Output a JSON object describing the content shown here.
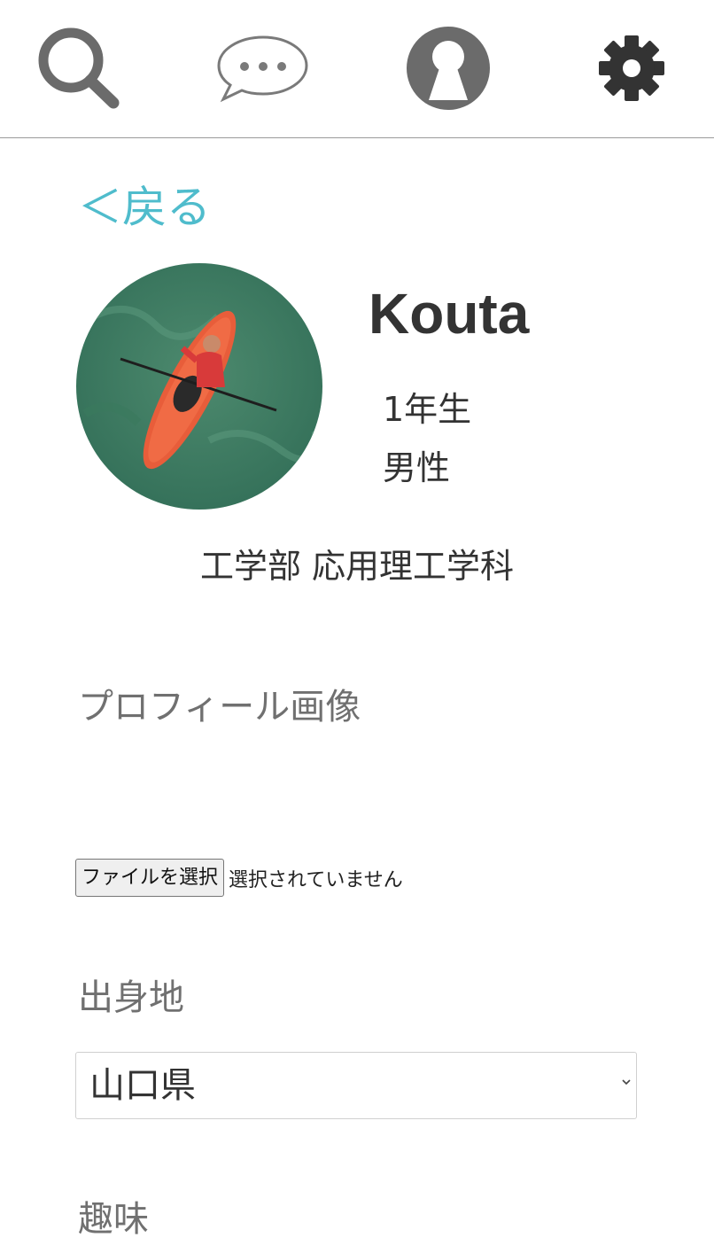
{
  "nav": {
    "items": [
      {
        "icon": "search-icon"
      },
      {
        "icon": "chat-bubble-icon"
      },
      {
        "icon": "profile-icon"
      },
      {
        "icon": "gear-icon"
      }
    ],
    "icon_color": "#6b6b6b"
  },
  "back_link": {
    "label": "＜戻る",
    "color": "#4fbccc"
  },
  "profile": {
    "name": "Kouta",
    "grade": "1年生",
    "gender": "男性",
    "department": "工学部 応用理工学科"
  },
  "form": {
    "profile_image": {
      "label": "プロフィール画像",
      "button_label": "ファイルを選択",
      "status": "選択されていません"
    },
    "hometown": {
      "label": "出身地",
      "selected": "山口県"
    },
    "hobby": {
      "label": "趣味"
    }
  }
}
